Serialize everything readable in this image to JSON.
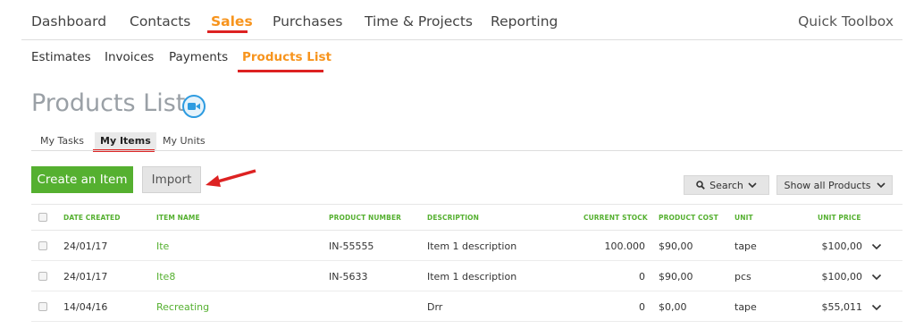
{
  "topnav": {
    "items": [
      {
        "label": "Dashboard"
      },
      {
        "label": "Contacts"
      },
      {
        "label": "Sales"
      },
      {
        "label": "Purchases"
      },
      {
        "label": "Time & Projects"
      },
      {
        "label": "Reporting"
      }
    ],
    "active_index": 2,
    "quick_toolbox": "Quick Toolbox"
  },
  "subnav": {
    "items": [
      {
        "label": "Estimates"
      },
      {
        "label": "Invoices"
      },
      {
        "label": "Payments"
      },
      {
        "label": "Products List"
      }
    ],
    "active_index": 3
  },
  "page": {
    "title": "Products List",
    "video_icon": "video-camera-icon"
  },
  "tabs": {
    "items": [
      {
        "label": "My Tasks"
      },
      {
        "label": "My Items"
      },
      {
        "label": "My Units"
      }
    ],
    "active_index": 1
  },
  "actions": {
    "create_label": "Create an Item",
    "import_label": "Import",
    "search_label": "Search",
    "filter_label": "Show all Products"
  },
  "table": {
    "headers": {
      "date_created": "DATE CREATED",
      "item_name": "ITEM NAME",
      "product_number": "PRODUCT NUMBER",
      "description": "DESCRIPTION",
      "current_stock": "CURRENT STOCK",
      "product_cost": "PRODUCT COST",
      "unit": "UNIT",
      "unit_price": "UNIT PRICE"
    },
    "rows": [
      {
        "date": "24/01/17",
        "name": "Ite",
        "number": "IN-55555",
        "description": "Item 1 description",
        "stock": "100.000",
        "cost": "$90,00",
        "unit": "tape",
        "price": "$100,00"
      },
      {
        "date": "24/01/17",
        "name": "Ite8",
        "number": "IN-5633",
        "description": "Item 1 description",
        "stock": "0",
        "cost": "$90,00",
        "unit": "pcs",
        "price": "$100,00"
      },
      {
        "date": "14/04/16",
        "name": "Recreating",
        "number": "",
        "description": "Drr",
        "stock": "0",
        "cost": "$0,00",
        "unit": "tape",
        "price": "$55,011"
      }
    ]
  },
  "colors": {
    "brand_orange": "#f7941d",
    "brand_green": "#55b030",
    "annotation_red": "#dd2222",
    "title_gray": "#9aa0a6"
  }
}
